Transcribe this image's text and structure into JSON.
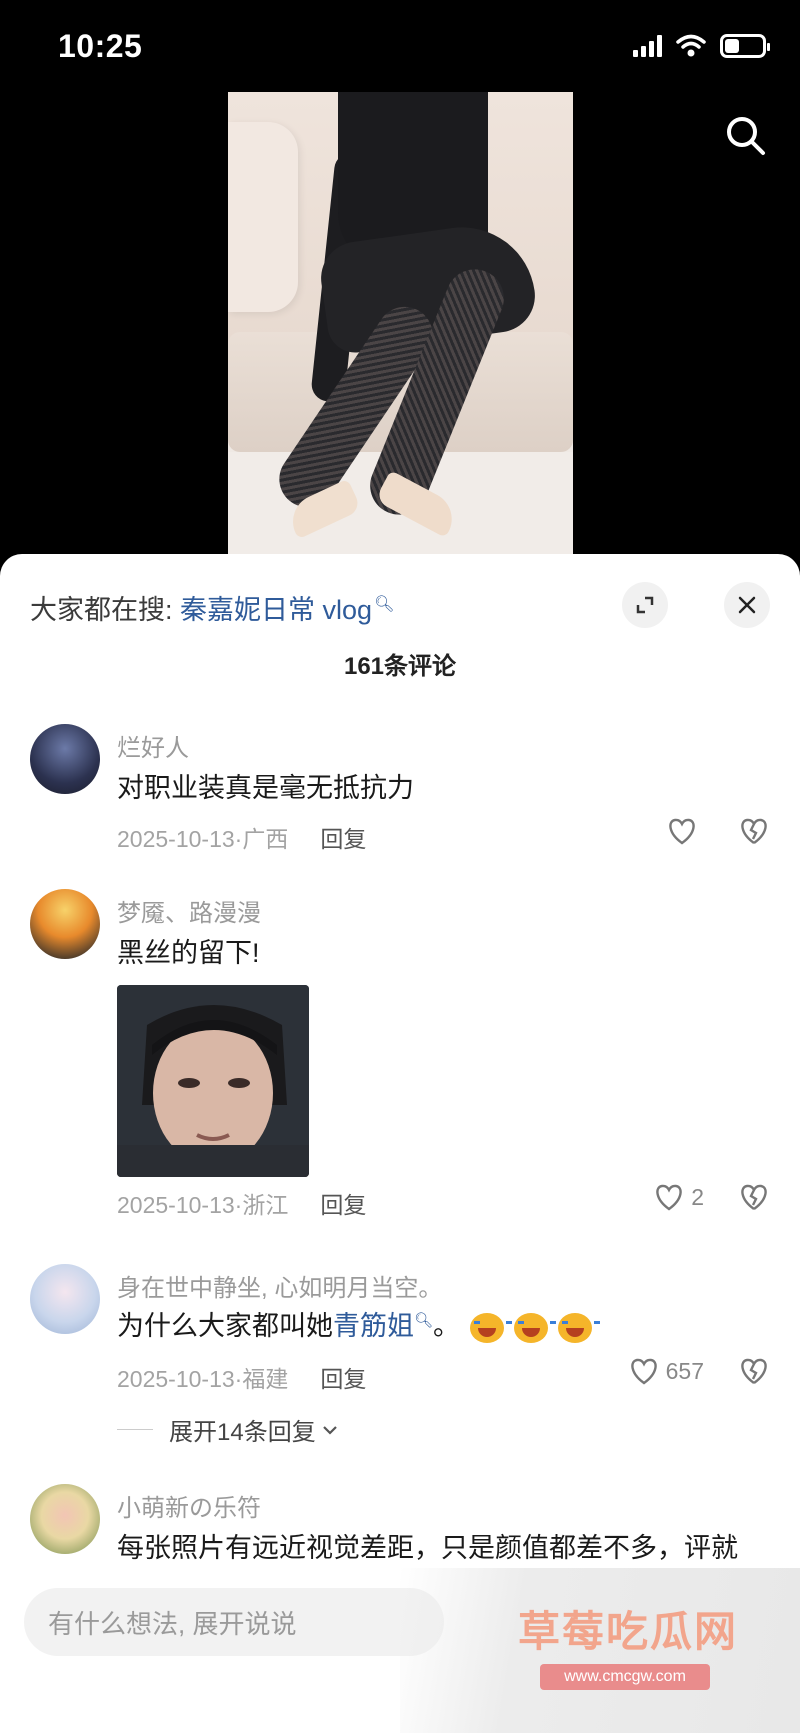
{
  "status_bar": {
    "time": "10:25"
  },
  "trending": {
    "prefix": "大家都在搜: ",
    "query": "秦嘉妮日常 vlog"
  },
  "comment_count": "161条评论",
  "comments": [
    {
      "user": "烂好人",
      "text": "对职业装真是毫无抵抗力",
      "date": "2025-10-13",
      "location": "广西",
      "reply": "回复",
      "likes": ""
    },
    {
      "user": "梦魇、路漫漫",
      "text": "黑丝的留下!",
      "date": "2025-10-13",
      "location": "浙江",
      "reply": "回复",
      "likes": "2"
    },
    {
      "user": "身在世中静坐, 心如明月当空。",
      "text_before": "为什么大家都叫她",
      "text_link": "青筋姐",
      "text_after": "。",
      "date": "2025-10-13",
      "location": "福建",
      "reply": "回复",
      "likes": "657",
      "expand_replies": "展开14条回复"
    },
    {
      "user": "小萌新の乐符",
      "text": "每张照片有远近视觉差距，只是颜值都差不多，评就"
    }
  ],
  "input": {
    "placeholder": "有什么想法, 展开说说"
  },
  "watermark": {
    "title": "草莓吃瓜网",
    "url": "www.cmcgw.com"
  }
}
